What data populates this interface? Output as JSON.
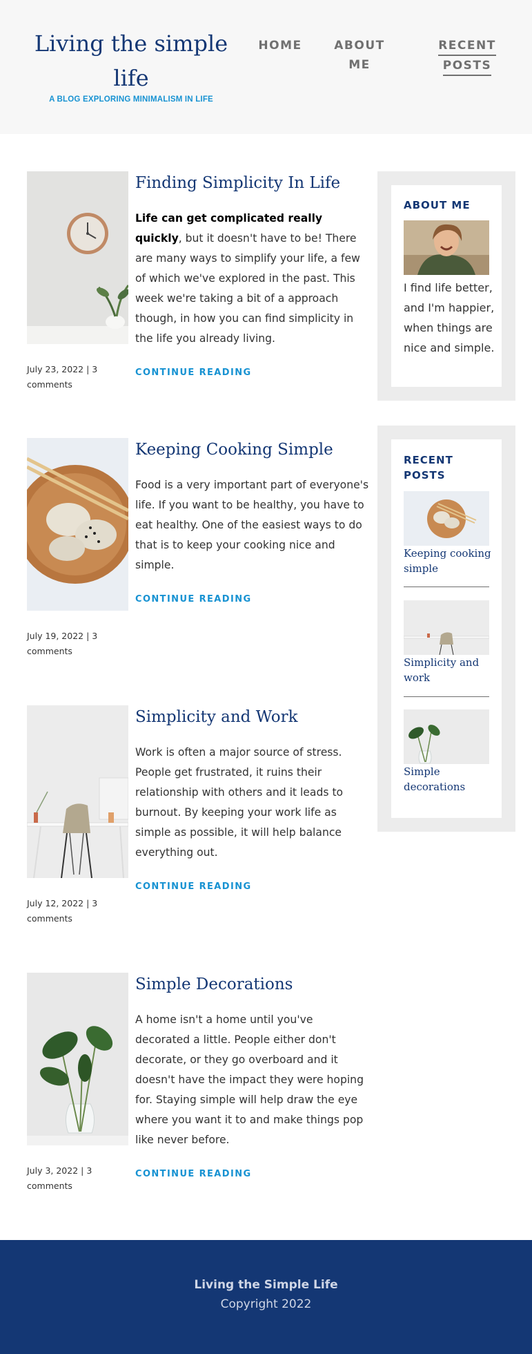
{
  "header": {
    "title_line1": "Living the simple",
    "title_line2": "life",
    "subtitle": "A BLOG EXPLORING MINIMALISM IN LIFE",
    "nav": {
      "home": "HOME",
      "about_line1": "ABOUT",
      "about_line2": "ME",
      "recent_line1": "RECENT",
      "recent_line2": "POSTS"
    }
  },
  "posts": [
    {
      "title": "Finding Simplicity In Life",
      "body_bold": "Life can get complicated really quickly",
      "body": ", but it doesn't have to be! There are many ways to simplify your life, a few of which we've explored in the past. This week we're taking a bit of a approach though, in how you can find simplicity in the life you already living.",
      "continue": "CONTINUE READING",
      "meta_line1": "July 23, 2022 | 3",
      "meta_line2": "comments",
      "image": "clock-icon"
    },
    {
      "title": "Keeping Cooking Simple",
      "body": "Food is a very important part of everyone's life. If you want to be healthy, you have to eat healthy. One of the easiest ways to do that is to keep your cooking nice and simple.",
      "continue": "CONTINUE READING",
      "meta_line1": "July 19, 2022 | 3",
      "meta_line2": "comments",
      "image": "dumplings-icon"
    },
    {
      "title": "Simplicity and Work",
      "body": "Work is often a major source of stress. People get frustrated, it ruins their relationship with others and it leads to burnout. By keeping your work life as simple as possible, it will help balance everything out.",
      "continue": "CONTINUE READING",
      "meta_line1": "July 12, 2022 | 3",
      "meta_line2": "comments",
      "image": "desk-chair-icon"
    },
    {
      "title": "Simple Decorations",
      "body": "A home isn't a home until you've decorated a little. People either don't decorate, or they go overboard and it doesn't have the impact they were hoping for. Staying simple will help draw the eye where you want it to and make things pop like never before.",
      "continue": "CONTINUE READING",
      "meta_line1": "July 3, 2022 | 3",
      "meta_line2": "comments",
      "image": "plant-vase-icon"
    }
  ],
  "sidebar": {
    "about": {
      "title": "ABOUT ME",
      "text": "I find life better, and I'm happier, when things are nice and simple."
    },
    "recent": {
      "title_line1": "RECENT",
      "title_line2": "POSTS",
      "items": [
        {
          "line1": "Keeping cooking",
          "line2": "simple"
        },
        {
          "line1": "Simplicity and",
          "line2": "work"
        },
        {
          "line1": "Simple",
          "line2": "decorations"
        }
      ]
    }
  },
  "footer": {
    "title": "Living the Simple Life",
    "copyright": "Copyright 2022"
  },
  "colors": {
    "navy": "#143774",
    "accent": "#1792d2",
    "header_bg": "#f7f7f7",
    "widget_bg": "#ececec"
  }
}
